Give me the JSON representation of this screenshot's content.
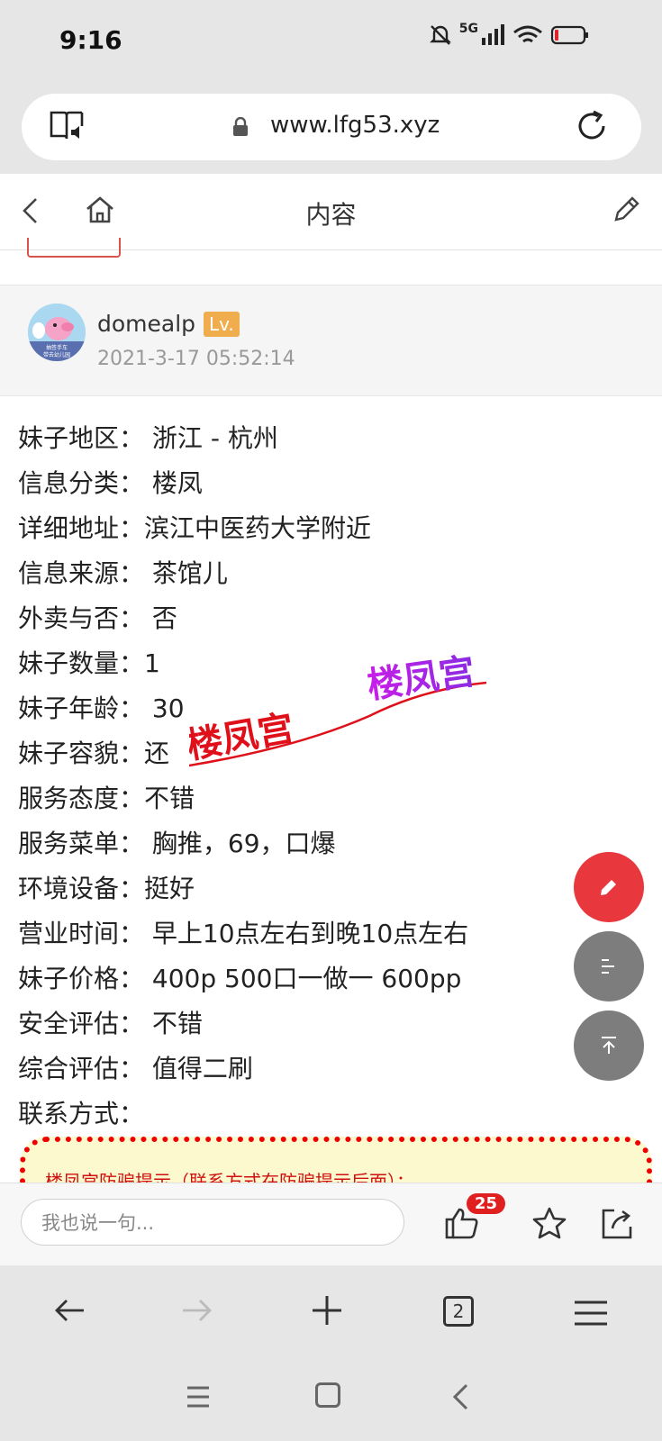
{
  "status_bar": {
    "time": "9:16",
    "network": "5G"
  },
  "address_bar": {
    "url": "www.lfg53.xyz"
  },
  "header": {
    "title": "内容"
  },
  "post": {
    "author": "domealp",
    "level_badge": "Lv.",
    "timestamp": "2021-3-17 05:52:14",
    "avatar_text": [
      "抽签手车",
      "带去幼儿园"
    ]
  },
  "content_lines": [
    {
      "label": "妹子地区：",
      "value": " 浙江 - 杭州"
    },
    {
      "label": "信息分类：",
      "value": " 楼凤"
    },
    {
      "label": "详细地址：",
      "value": "滨江中医药大学附近"
    },
    {
      "label": "信息来源：",
      "value": " 茶馆儿"
    },
    {
      "label": "外卖与否：",
      "value": " 否"
    },
    {
      "label": "妹子数量：",
      "value": "1"
    },
    {
      "label": "妹子年龄：",
      "value": " 30"
    },
    {
      "label": "妹子容貌：",
      "value": "还"
    },
    {
      "label": "服务态度：",
      "value": "不错"
    },
    {
      "label": "服务菜单：",
      "value": " 胸推，69，口爆"
    },
    {
      "label": "环境设备：",
      "value": "挺好"
    },
    {
      "label": "营业时间：",
      "value": " 早上10点左右到晚10点左右"
    },
    {
      "label": "妹子价格：",
      "value": " 400p 500口一做一 600pp"
    },
    {
      "label": "安全评估：",
      "value": " 不错"
    },
    {
      "label": "综合评估：",
      "value": " 值得二刷"
    },
    {
      "label": "联系方式：",
      "value": ""
    }
  ],
  "watermark": {
    "text_a": "楼凤宫",
    "text_b": "楼凤宫"
  },
  "warning": {
    "text": "楼凤宫防骗提示（联系方式在防骗提示后面）："
  },
  "comment_bar": {
    "placeholder": "我也说一句...",
    "like_count": "25"
  },
  "browser_nav": {
    "tab_count": "2"
  },
  "colors": {
    "accent_red": "#e8373d",
    "badge_orange": "#f0ad4e",
    "fab_gray": "#7d7d7d"
  },
  "icons": [
    "reader-mode-icon",
    "lock-icon",
    "reload-icon",
    "back-icon",
    "home-icon",
    "edit-icon",
    "pencil-icon",
    "toc-icon",
    "scroll-top-icon",
    "like-icon",
    "star-icon",
    "share-icon",
    "arrow-left-icon",
    "arrow-right-icon",
    "plus-icon",
    "tabs-icon",
    "menu-icon"
  ]
}
